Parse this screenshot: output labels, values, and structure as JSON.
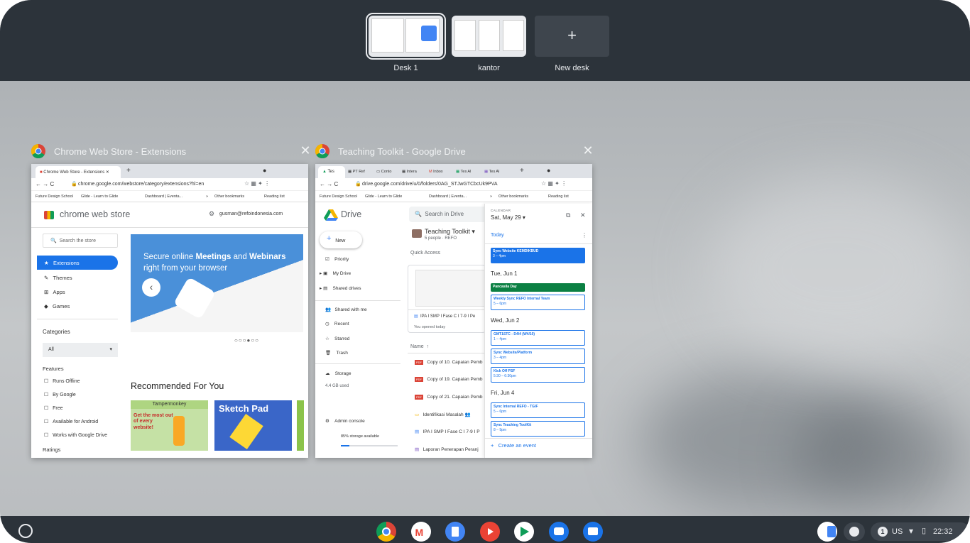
{
  "desks": [
    {
      "label": "Desk 1",
      "active": true
    },
    {
      "label": "kantor",
      "active": false
    }
  ],
  "new_desk": {
    "icon": "+",
    "label": "New desk"
  },
  "windows": [
    {
      "title": "Chrome Web Store - Extensions",
      "tab": "Chrome Web Store - Extensions",
      "url": "chrome.google.com/webstore/category/extensions?hl=en",
      "bookmarks": [
        "Future Design School",
        "Glide - Learn to Glide",
        "Dashboard | Eventa...",
        "»",
        "Other bookmarks",
        "Reading list"
      ],
      "store_name": "chrome web store",
      "account": "gusman@refoindonesia.com",
      "search_placeholder": "Search the store",
      "nav": [
        "Extensions",
        "Themes",
        "Apps",
        "Games"
      ],
      "categories_label": "Categories",
      "categories_value": "All",
      "features_label": "Features",
      "features": [
        "Runs Offline",
        "By Google",
        "Free",
        "Available for Android",
        "Works with Google Drive"
      ],
      "ratings_label": "Ratings",
      "banner_text_1": "Secure online",
      "banner_bold_1": "Meetings",
      "banner_and": "and",
      "banner_bold_2": "Webinars",
      "banner_text_2": "right from your browser",
      "recommended": "Recommended For You",
      "card1_title": "Tampermonkey",
      "card1_text": "Get the most out of every website!",
      "card2_text": "Sketch Pad"
    },
    {
      "title": "Teaching Toolkit - Google Drive",
      "tabs": [
        "Tes",
        "PT Ref",
        "Conto",
        "Intera",
        "Inbox",
        "Tes Al",
        "Tes Al"
      ],
      "url": "drive.google.com/drive/u/0/folders/0AG_STJwGTCbcUk9PVA",
      "bookmarks": [
        "Future Design School",
        "Glide - Learn to Glide",
        "Dashboard | Eventa...",
        "»",
        "Other bookmarks",
        "Reading list"
      ],
      "drive_name": "Drive",
      "search_placeholder": "Search in Drive",
      "new_label": "New",
      "nav": [
        "Priority",
        "My Drive",
        "Shared drives",
        "Shared with me",
        "Recent",
        "Starred",
        "Trash",
        "Storage"
      ],
      "storage_used": "4.4 GB used",
      "admin": "Admin console",
      "storage_avail": "85% storage available",
      "storage_fraction": 0.15,
      "folder_name": "Teaching Toolkit",
      "folder_sub": "5 people · REFO",
      "quick_access": "Quick Access",
      "qa_file": "IPA I SMP I Fase C I 7-9 I Pe",
      "qa_sub": "You opened today",
      "name_header": "Name",
      "files": [
        "Copy of 10. Capaian Pemb",
        "Copy of 19. Capaian Pemb",
        "Copy of 21. Capaian Pemb",
        "Identifikasi Masalah",
        "IPA I SMP I Fase C I 7-9 I P",
        "Laporan Penerapan Peranj"
      ],
      "calendar": {
        "label": "CALENDAR",
        "date": "Sat, May 29",
        "today": "Today",
        "create": "Create an event",
        "groups": [
          {
            "day": "",
            "events": [
              {
                "title": "Sync Website KEMDIKBUD",
                "time": "3 – 4pm",
                "style": "filled-blue"
              }
            ]
          },
          {
            "day": "Tue, Jun 1",
            "events": [
              {
                "title": "Pancasila Day",
                "time": "",
                "style": "filled-green"
              },
              {
                "title": "Weekly Sync REFO Internal Team",
                "time": "5 – 6pm",
                "style": "outline"
              }
            ]
          },
          {
            "day": "Wed, Jun 2",
            "events": [
              {
                "title": "GMT1STC - D4/4 (W4/10)",
                "time": "1 – 4pm",
                "style": "outline"
              },
              {
                "title": "Sync Website/Platform",
                "time": "3 – 4pm",
                "style": "outline"
              },
              {
                "title": "Kick Off PSF",
                "time": "5:30 – 6:30pm",
                "style": "outline"
              }
            ]
          },
          {
            "day": "Fri, Jun 4",
            "events": [
              {
                "title": "Sync Internal REFO - TGIF",
                "time": "5 – 6pm",
                "style": "outline"
              },
              {
                "title": "Sync Teaching ToolKit",
                "time": "8 – 9pm",
                "style": "outline"
              }
            ]
          }
        ]
      }
    }
  ],
  "shelf": {
    "apps": [
      "chrome-icon",
      "gmail-icon",
      "docs-icon",
      "youtube-icon",
      "play-store-icon",
      "messages-icon",
      "files-icon"
    ],
    "status": {
      "badge": "1",
      "locale": "US",
      "time": "22:32"
    }
  },
  "colors": {
    "shelf": "#2c333a",
    "blue": "#1a73e8",
    "green": "#0b8043",
    "accent_blue": "#4285f4"
  }
}
